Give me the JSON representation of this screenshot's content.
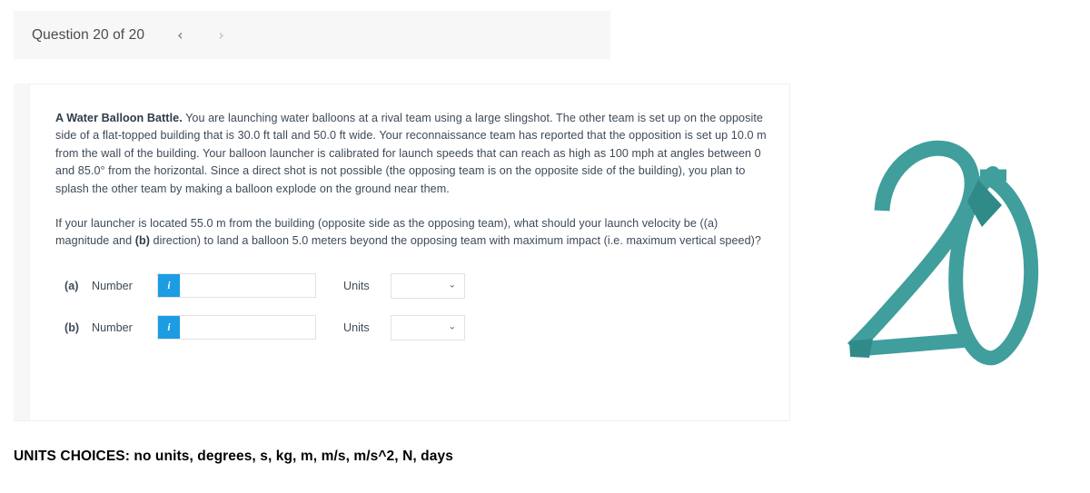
{
  "header": {
    "counter_text": "Question 20 of 20",
    "prev_icon": "‹",
    "next_icon": "›"
  },
  "question": {
    "title": "A Water Balloon Battle.",
    "paragraph_1_rest": " You are launching water balloons at a rival team using a large slingshot. The other team is set up on the opposite side of a flat-topped building that is 30.0 ft tall and 50.0 ft wide. Your reconnaissance team has reported that the opposition is set up 10.0 m from the wall of the building. Your balloon launcher is calibrated for launch speeds that can reach as high as 100 mph at angles between 0 and 85.0° from the horizontal. Since a direct shot is not possible (the opposing team is on the opposite side of the building), you plan to splash the other team by making a balloon explode on the ground near them.",
    "paragraph_2_a": "If your launcher is located 55.0 m from the building (opposite side as the opposing team), what should your launch velocity be ((a) magnitude and ",
    "paragraph_2_b": "(b)",
    "paragraph_2_c": " direction) to land a balloon 5.0 meters beyond the opposing team with maximum impact (i.e. maximum vertical speed)?"
  },
  "answers": {
    "number_label": "Number",
    "units_label": "Units",
    "info_badge_glyph": "i",
    "chevron_down_glyph": "⌄",
    "rows": [
      {
        "part": "(a)",
        "value": "",
        "placeholder": "",
        "unit_value": ""
      },
      {
        "part": "(b)",
        "value": "",
        "placeholder": "",
        "unit_value": ""
      }
    ]
  },
  "footer": {
    "units_choices_text": "UNITS CHOICES: no units, degrees, s, kg, m, m/s, m/s^2, N, days"
  },
  "watermark": {
    "label": "20",
    "color": "#409e9c"
  },
  "colors": {
    "header_band": "#f7f7f7",
    "info_badge_blue": "#1b9ce3",
    "body_text": "#3e4a57",
    "watermark_teal": "#409e9c"
  }
}
